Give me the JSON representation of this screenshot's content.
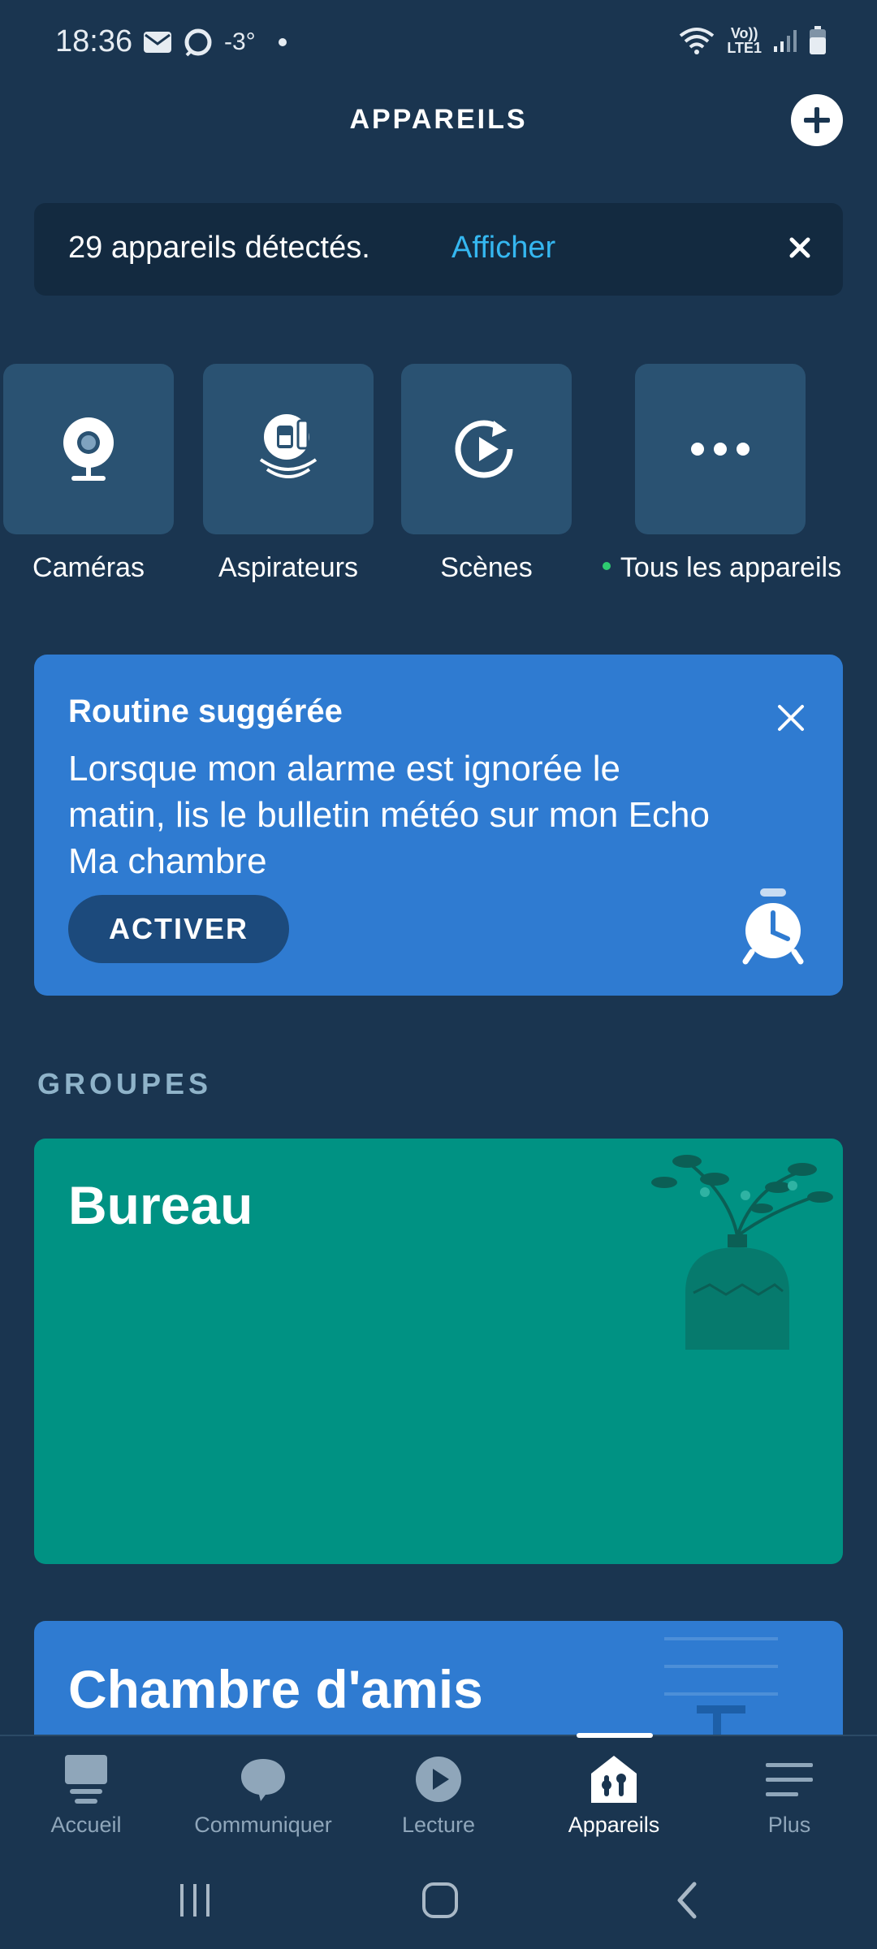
{
  "status_bar": {
    "time": "18:36",
    "temperature": "-3°",
    "network_label_top": "Vo))",
    "network_label_bottom": "LTE1"
  },
  "header": {
    "title": "APPAREILS"
  },
  "detect_banner": {
    "text": "29 appareils détectés.",
    "link": "Afficher"
  },
  "categories": [
    {
      "label": "Caméras",
      "icon": "camera-icon"
    },
    {
      "label": "Aspirateurs",
      "icon": "vacuum-icon"
    },
    {
      "label": "Scènes",
      "icon": "scene-play-icon"
    },
    {
      "label": "Tous les appareils",
      "icon": "more-dots-icon"
    }
  ],
  "routine": {
    "title": "Routine suggérée",
    "description": "Lorsque mon alarme est ignorée le matin, lis le bulletin météo sur mon Echo Ma chambre",
    "button": "ACTIVER"
  },
  "groups": {
    "heading": "GROUPES",
    "items": [
      {
        "name": "Bureau"
      },
      {
        "name": "Chambre d'amis"
      }
    ]
  },
  "bottom_nav": {
    "items": [
      {
        "label": "Accueil",
        "icon": "home-icon"
      },
      {
        "label": "Communiquer",
        "icon": "chat-bubble-icon"
      },
      {
        "label": "Lecture",
        "icon": "play-icon"
      },
      {
        "label": "Appareils",
        "icon": "devices-icon",
        "active": true
      },
      {
        "label": "Plus",
        "icon": "menu-icon"
      }
    ]
  },
  "colors": {
    "background": "#1a3550",
    "accent_link": "#35b7f0",
    "routine_card": "#2f7bd1",
    "bureau_card": "#009283"
  }
}
